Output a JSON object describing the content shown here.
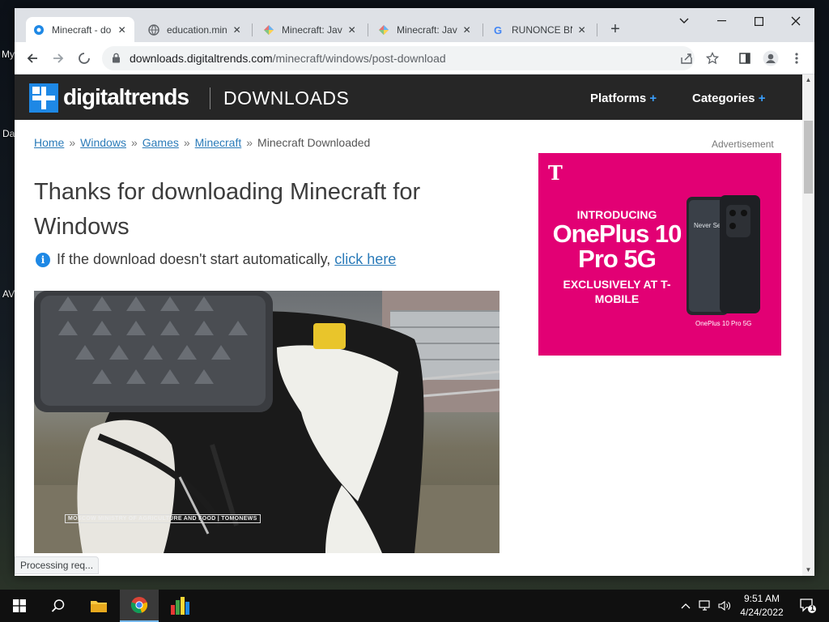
{
  "desktop": {
    "labels": [
      "My",
      "Da",
      "AV"
    ]
  },
  "browser": {
    "tabs": [
      {
        "title": "Minecraft - do",
        "active": true
      },
      {
        "title": "education.min",
        "active": false
      },
      {
        "title": "Minecraft: Java",
        "active": false
      },
      {
        "title": "Minecraft: Java",
        "active": false
      },
      {
        "title": "RUNONCE BNE",
        "active": false
      }
    ],
    "url_host": "downloads.digitaltrends.com",
    "url_path": "/minecraft/windows/post-download",
    "status": "Processing req..."
  },
  "page": {
    "header": {
      "brand": "digitaltrends",
      "section": "DOWNLOADS",
      "nav": [
        {
          "label": "Platforms",
          "plus": "+"
        },
        {
          "label": "Categories",
          "plus": "+"
        }
      ]
    },
    "breadcrumb": {
      "links": [
        "Home",
        "Windows",
        "Games",
        "Minecraft"
      ],
      "current": "Minecraft Downloaded",
      "separator": "»"
    },
    "headline": "Thanks for downloading Minecraft for Windows",
    "download_note": "If the download doesn't start automatically,",
    "download_link": "click here",
    "hero_caption": "MOSCOW MINISTRY OF AGRICULTURE AND FOOD | TOMONEWS",
    "ad": {
      "label": "Advertisement",
      "brand_mark": "T",
      "line1": "INTRODUCING",
      "line2": "OnePlus 10 Pro 5G",
      "line3": "EXCLUSIVELY AT T-MOBILE",
      "phone_caption": "OnePlus 10 Pro 5G",
      "phone_screen_text": "Never Settle"
    }
  },
  "taskbar": {
    "time": "9:51 AM",
    "date": "4/24/2022",
    "notification_count": "1"
  },
  "colors": {
    "accent": "#1e88e5",
    "ad_magenta": "#e20074",
    "link": "#2b7bb9",
    "header_bg": "#262626"
  }
}
